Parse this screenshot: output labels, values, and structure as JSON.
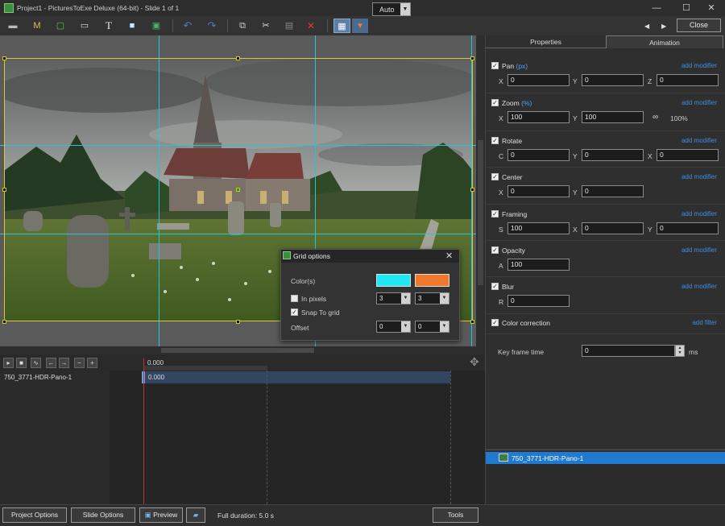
{
  "window": {
    "title": "Project1 - PicturesToExe Deluxe (64-bit) - Slide 1 of 1",
    "minimize": "—",
    "maximize": "☐",
    "close": "✕"
  },
  "toolbar": {
    "icons": [
      "camera-icon",
      "mask-icon",
      "frame-icon",
      "video-icon",
      "text-icon",
      "rectangle-icon",
      "image-icon",
      "undo-icon",
      "redo-icon",
      "copy-icon",
      "cut-icon",
      "paste-icon",
      "delete-icon",
      "grid-icon",
      "grid-options-icon"
    ],
    "glyphs": {
      "camera": "▬",
      "mask": "M",
      "frame": "▢",
      "video": "▭",
      "text": "T",
      "rect": "■",
      "image": "▣",
      "undo": "↶",
      "redo": "↷",
      "copy": "⧉",
      "cut": "✂",
      "paste": "▤",
      "delete": "✕",
      "grid": "▦",
      "gridopt": "▾"
    },
    "zoom_value": "Auto",
    "nav_prev": "◀",
    "nav_next": "▶",
    "close_label": "Close"
  },
  "tabs": {
    "properties": "Properties",
    "animation": "Animation"
  },
  "animation": {
    "add_modifier": "add modifier",
    "add_filter": "add filter",
    "pan": {
      "label": "Pan",
      "unit": "(px)",
      "x_label": "X",
      "x": "0",
      "y_label": "Y",
      "y": "0",
      "z_label": "Z",
      "z": "0"
    },
    "zoom": {
      "label": "Zoom",
      "unit": "(%)",
      "x_label": "X",
      "x": "100",
      "y_label": "Y",
      "y": "100",
      "link": "100%"
    },
    "rotate": {
      "label": "Rotate",
      "c_label": "C",
      "c": "0",
      "y_label": "Y",
      "y": "0",
      "x_label": "X",
      "x": "0"
    },
    "center": {
      "label": "Center",
      "x_label": "X",
      "x": "0",
      "y_label": "Y",
      "y": "0"
    },
    "framing": {
      "label": "Framing",
      "s_label": "S",
      "s": "100",
      "x_label": "X",
      "x": "0",
      "y_label": "Y",
      "y": "0"
    },
    "opacity": {
      "label": "Opacity",
      "a_label": "A",
      "a": "100"
    },
    "blur": {
      "label": "Blur",
      "r_label": "R",
      "r": "0"
    },
    "color_correction": {
      "label": "Color correction"
    },
    "keyframe": {
      "label": "Key frame time",
      "value": "0",
      "unit": "ms"
    }
  },
  "objects_list": {
    "items": [
      "750_3771-HDR-Pano-1"
    ]
  },
  "timeline": {
    "buttons": [
      "▸",
      "■",
      "∿",
      "←",
      "→",
      "−",
      "+"
    ],
    "timecode": "0.000",
    "track_name": "750_3771-HDR-Pano-1",
    "track_value": "0.000"
  },
  "grid_dialog": {
    "title": "Grid options",
    "colors_label": "Color(s)",
    "color1": "#1ee8f4",
    "color2": "#f0782c",
    "in_pixels_label": "In pixels",
    "in_pixels_checked": false,
    "snap_label": "Snap To grid",
    "snap_checked": true,
    "grid_x": "3",
    "grid_y": "3",
    "offset_label": "Offset",
    "offset_x": "0",
    "offset_y": "0"
  },
  "bottom": {
    "project_options": "Project Options",
    "slide_options": "Slide Options",
    "preview": "Preview",
    "duration": "Full duration: 5.0 s",
    "tools": "Tools"
  },
  "colors": {
    "accent": "#1f7ad0",
    "grid_line": "#24c6d6",
    "link_blue": "#3f8ddf"
  }
}
